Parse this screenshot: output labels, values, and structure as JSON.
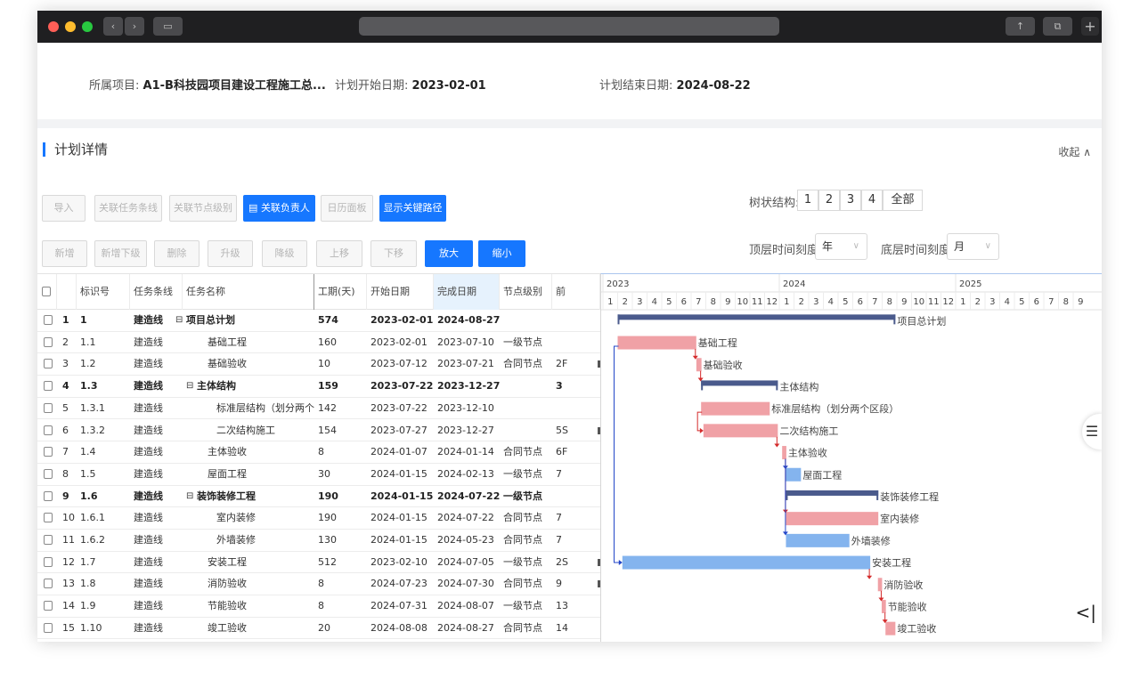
{
  "window": {
    "add_tab": "+"
  },
  "project": {
    "label": "所属项目:",
    "name": "A1-B科技园项目建设工程施工总...",
    "start_label": "计划开始日期:",
    "start_date": "2023-02-01",
    "end_label": "计划结束日期:",
    "end_date": "2024-08-22"
  },
  "section": {
    "title": "计划详情",
    "collapse_label": "收起"
  },
  "toolbar1": [
    "导入",
    "关联任务条线",
    "关联节点级别",
    "关联负责人",
    "日历面板",
    "显示关键路径"
  ],
  "toolbar2": [
    "新增",
    "新增下级",
    "删除",
    "升级",
    "降级",
    "上移",
    "下移",
    "放大",
    "缩小"
  ],
  "controls": {
    "tree_label": "树状结构:",
    "tree_levels": [
      "1",
      "2",
      "3",
      "4",
      "全部"
    ],
    "top_scale_label": "顶层时间刻度:",
    "top_scale_value": "年",
    "bottom_scale_label": "底层时间刻度:",
    "bottom_scale_value": "月"
  },
  "columns": [
    "标识号",
    "任务条线",
    "任务名称",
    "工期(天)",
    "开始日期",
    "完成日期",
    "节点级别",
    "前"
  ],
  "rows": [
    {
      "no": "1",
      "id": "1",
      "line": "建造线",
      "name": "项目总计划",
      "dur": "574",
      "start": "2023-02-01",
      "end": "2024-08-27",
      "level": "",
      "pre": "",
      "bold": true,
      "indent": 0,
      "exp": "⊟"
    },
    {
      "no": "2",
      "id": "1.1",
      "line": "建造线",
      "name": "基础工程",
      "dur": "160",
      "start": "2023-02-01",
      "end": "2023-07-10",
      "level": "一级节点",
      "pre": "",
      "bold": false,
      "indent": 1,
      "exp": ""
    },
    {
      "no": "3",
      "id": "1.2",
      "line": "建造线",
      "name": "基础验收",
      "dur": "10",
      "start": "2023-07-12",
      "end": "2023-07-21",
      "level": "合同节点",
      "pre": "2F",
      "bold": false,
      "indent": 1,
      "exp": ""
    },
    {
      "no": "4",
      "id": "1.3",
      "line": "建造线",
      "name": "主体结构",
      "dur": "159",
      "start": "2023-07-22",
      "end": "2023-12-27",
      "level": "",
      "pre": "3",
      "bold": true,
      "indent": 1,
      "exp": "⊟"
    },
    {
      "no": "5",
      "id": "1.3.1",
      "line": "建造线",
      "name": "标准层结构（划分两个区段",
      "dur": "142",
      "start": "2023-07-22",
      "end": "2023-12-10",
      "level": "",
      "pre": "",
      "bold": false,
      "indent": 2,
      "exp": ""
    },
    {
      "no": "6",
      "id": "1.3.2",
      "line": "建造线",
      "name": "二次结构施工",
      "dur": "154",
      "start": "2023-07-27",
      "end": "2023-12-27",
      "level": "",
      "pre": "5S",
      "bold": false,
      "indent": 2,
      "exp": ""
    },
    {
      "no": "7",
      "id": "1.4",
      "line": "建造线",
      "name": "主体验收",
      "dur": "8",
      "start": "2024-01-07",
      "end": "2024-01-14",
      "level": "合同节点",
      "pre": "6F",
      "bold": false,
      "indent": 1,
      "exp": ""
    },
    {
      "no": "8",
      "id": "1.5",
      "line": "建造线",
      "name": "屋面工程",
      "dur": "30",
      "start": "2024-01-15",
      "end": "2024-02-13",
      "level": "一级节点",
      "pre": "7",
      "bold": false,
      "indent": 1,
      "exp": ""
    },
    {
      "no": "9",
      "id": "1.6",
      "line": "建造线",
      "name": "装饰装修工程",
      "dur": "190",
      "start": "2024-01-15",
      "end": "2024-07-22",
      "level": "一级节点",
      "pre": "",
      "bold": true,
      "indent": 1,
      "exp": "⊟"
    },
    {
      "no": "10",
      "id": "1.6.1",
      "line": "建造线",
      "name": "室内装修",
      "dur": "190",
      "start": "2024-01-15",
      "end": "2024-07-22",
      "level": "合同节点",
      "pre": "7",
      "bold": false,
      "indent": 2,
      "exp": ""
    },
    {
      "no": "11",
      "id": "1.6.2",
      "line": "建造线",
      "name": "外墙装修",
      "dur": "130",
      "start": "2024-01-15",
      "end": "2024-05-23",
      "level": "合同节点",
      "pre": "7",
      "bold": false,
      "indent": 2,
      "exp": ""
    },
    {
      "no": "12",
      "id": "1.7",
      "line": "建造线",
      "name": "安装工程",
      "dur": "512",
      "start": "2023-02-10",
      "end": "2024-07-05",
      "level": "一级节点",
      "pre": "2S",
      "bold": false,
      "indent": 1,
      "exp": ""
    },
    {
      "no": "13",
      "id": "1.8",
      "line": "建造线",
      "name": "消防验收",
      "dur": "8",
      "start": "2024-07-23",
      "end": "2024-07-30",
      "level": "合同节点",
      "pre": "9",
      "bold": false,
      "indent": 1,
      "exp": ""
    },
    {
      "no": "14",
      "id": "1.9",
      "line": "建造线",
      "name": "节能验收",
      "dur": "8",
      "start": "2024-07-31",
      "end": "2024-08-07",
      "level": "一级节点",
      "pre": "13",
      "bold": false,
      "indent": 1,
      "exp": ""
    },
    {
      "no": "15",
      "id": "1.10",
      "line": "建造线",
      "name": "竣工验收",
      "dur": "20",
      "start": "2024-08-08",
      "end": "2024-08-27",
      "level": "合同节点",
      "pre": "14",
      "bold": false,
      "indent": 1,
      "exp": ""
    }
  ],
  "gantt": {
    "years": [
      "2023",
      "2024",
      "2025"
    ],
    "months": [
      "1",
      "2",
      "3",
      "4",
      "5",
      "6",
      "7",
      "8",
      "9",
      "10",
      "11",
      "12",
      "1",
      "2",
      "3",
      "4",
      "5",
      "6",
      "7",
      "8",
      "9",
      "10",
      "11",
      "12",
      "1",
      "2",
      "3",
      "4",
      "5",
      "6",
      "7",
      "8",
      "9"
    ],
    "bars": [
      {
        "label": "项目总计划",
        "start": "2023-02-01",
        "end": "2024-08-27",
        "kind": "summary"
      },
      {
        "label": "基础工程",
        "start": "2023-02-01",
        "end": "2023-07-10",
        "kind": "critical"
      },
      {
        "label": "基础验收",
        "start": "2023-07-12",
        "end": "2023-07-21",
        "kind": "critical"
      },
      {
        "label": "主体结构",
        "start": "2023-07-22",
        "end": "2023-12-27",
        "kind": "summary"
      },
      {
        "label": "标准层结构（划分两个区段）",
        "start": "2023-07-22",
        "end": "2023-12-10",
        "kind": "critical"
      },
      {
        "label": "二次结构施工",
        "start": "2023-07-27",
        "end": "2023-12-27",
        "kind": "critical"
      },
      {
        "label": "主体验收",
        "start": "2024-01-07",
        "end": "2024-01-14",
        "kind": "critical"
      },
      {
        "label": "屋面工程",
        "start": "2024-01-15",
        "end": "2024-02-13",
        "kind": "normal"
      },
      {
        "label": "装饰装修工程",
        "start": "2024-01-15",
        "end": "2024-07-22",
        "kind": "summary"
      },
      {
        "label": "室内装修",
        "start": "2024-01-15",
        "end": "2024-07-22",
        "kind": "critical"
      },
      {
        "label": "外墙装修",
        "start": "2024-01-15",
        "end": "2024-05-23",
        "kind": "normal"
      },
      {
        "label": "安装工程",
        "start": "2023-02-10",
        "end": "2024-07-05",
        "kind": "normal"
      },
      {
        "label": "消防验收",
        "start": "2024-07-23",
        "end": "2024-07-30",
        "kind": "critical"
      },
      {
        "label": "节能验收",
        "start": "2024-07-31",
        "end": "2024-08-07",
        "kind": "critical"
      },
      {
        "label": "竣工验收",
        "start": "2024-08-08",
        "end": "2024-08-27",
        "kind": "critical"
      }
    ],
    "colors": {
      "summary": "#4a5a8c",
      "critical": "#f0a1a6",
      "normal": "#84b4ee",
      "link_red": "#d42b2b",
      "link_blue": "#2346c8"
    }
  },
  "side": {
    "settings_icon": "⚙",
    "collapse_icon": "<|"
  }
}
